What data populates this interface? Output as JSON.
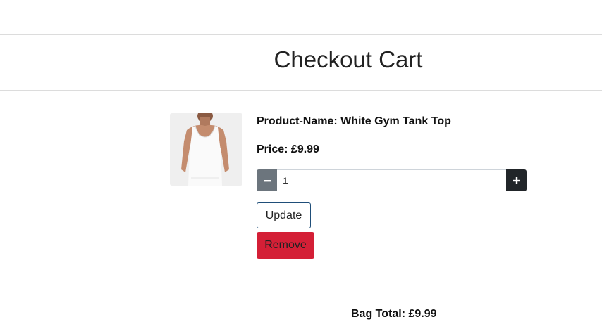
{
  "header": {
    "title": "Checkout Cart"
  },
  "cart": {
    "items": [
      {
        "name_text": "Product-Name: White Gym Tank Top",
        "price_text": "Price: £9.99",
        "quantity": "1",
        "image_icon": "tank-top-product-image",
        "minus_icon": "minus-icon",
        "plus_icon": "plus-icon",
        "update_label": "Update",
        "remove_label": "Remove"
      }
    ],
    "bag_total_text": "Bag Total: £9.99"
  },
  "colors": {
    "remove_button": "#d41f36",
    "update_border": "#1f4e79",
    "minus_button": "#6c757d",
    "plus_button": "#212529"
  }
}
